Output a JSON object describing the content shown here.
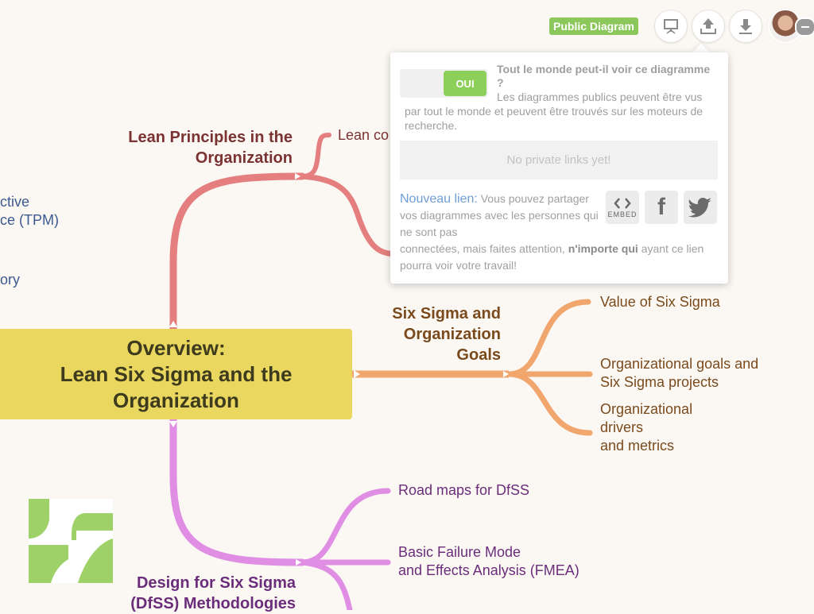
{
  "header": {
    "public_badge": "Public Diagram",
    "buttons": [
      "present-icon",
      "share-icon",
      "download-icon"
    ],
    "avatar": "user-avatar"
  },
  "share_popup": {
    "toggle_label": "OUI",
    "question_title": "Tout le monde peut-il voir ce diagramme ?",
    "question_desc": "Les diagrammes publics peuvent être vus par tout le monde et peuvent être trouvés sur les moteurs de recherche.",
    "private_links_empty": "No private links yet!",
    "new_link_title": "Nouveau lien:",
    "new_link_text_1": "Vous pouvez partager vos diagrammes avec les personnes qui ne sont pas",
    "new_link_text_2": "connectées, mais faites attention,",
    "new_link_bold": "n'importe qui",
    "new_link_text_3": "ayant ce lien pourra voir votre travail!",
    "share_options": [
      {
        "icon": "embed-icon",
        "label": "EMBED"
      },
      {
        "icon": "facebook-icon",
        "label": "f"
      },
      {
        "icon": "twitter-icon",
        "label": ""
      }
    ]
  },
  "mindmap": {
    "central": [
      "Overview:",
      "Lean Six Sigma and the",
      "Organization"
    ],
    "lean_branch": {
      "title": [
        "Lean Principles in the",
        "Organization"
      ],
      "child": "Lean co",
      "color": "#e57f7f",
      "title_color": "#7a3232"
    },
    "left_fragments": [
      "ctive",
      "ce (TPM)",
      "ory"
    ],
    "sigma_branch": {
      "title": [
        "Six Sigma and",
        "Organization",
        "Goals"
      ],
      "children": [
        [
          "Value of Six Sigma"
        ],
        [
          "Organizational goals and",
          "Six Sigma projects"
        ],
        [
          "Organizational",
          "drivers",
          "and metrics"
        ]
      ],
      "color": "#f0a66c",
      "title_color": "#7a4a1c"
    },
    "dfss_branch": {
      "title": [
        "Design for Six Sigma",
        "(DfSS) Methodologies"
      ],
      "children": [
        [
          "Road maps for DfSS"
        ],
        [
          "Basic Failure Mode",
          "and Effects Analysis (FMEA)"
        ]
      ],
      "color": "#e08ee4",
      "title_color": "#6b2d7a"
    }
  },
  "colors": {
    "background": "#fbf8f4",
    "central": "#e9d75f",
    "badge": "#8bc75a",
    "toggle_on": "#8ccf59",
    "link_blue": "#6f9fd8"
  }
}
